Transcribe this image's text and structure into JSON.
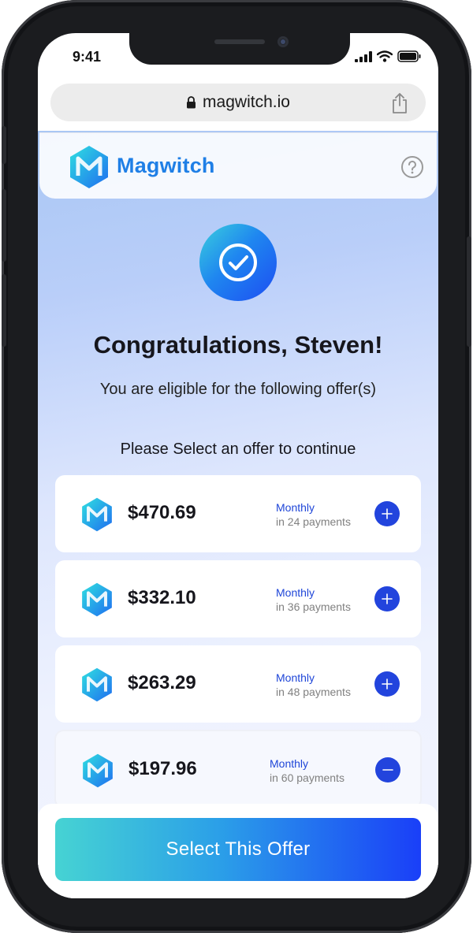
{
  "status_bar": {
    "time": "9:41"
  },
  "browser": {
    "url": "magwitch.io"
  },
  "brand": {
    "name": "Magwitch",
    "color": "#1f7fe6"
  },
  "main": {
    "heading": "Congratulations, Steven!",
    "subheading": "You are eligible for the following offer(s)",
    "prompt": "Please Select an offer to continue"
  },
  "offers": [
    {
      "amount": "$470.69",
      "period": "Monthly",
      "payments": "in 24 payments",
      "selected": false,
      "toggle_icon": "plus-icon"
    },
    {
      "amount": "$332.10",
      "period": "Monthly",
      "payments": "in 36 payments",
      "selected": false,
      "toggle_icon": "plus-icon"
    },
    {
      "amount": "$263.29",
      "period": "Monthly",
      "payments": "in 48 payments",
      "selected": false,
      "toggle_icon": "plus-icon"
    },
    {
      "amount": "$197.96",
      "period": "Monthly",
      "payments": "in 60 payments",
      "selected": true,
      "toggle_icon": "minus-icon"
    }
  ],
  "footer": {
    "cta_label": "Select This Offer"
  },
  "colors": {
    "accent": "#2244dd",
    "period_text": "#1f46d8"
  }
}
